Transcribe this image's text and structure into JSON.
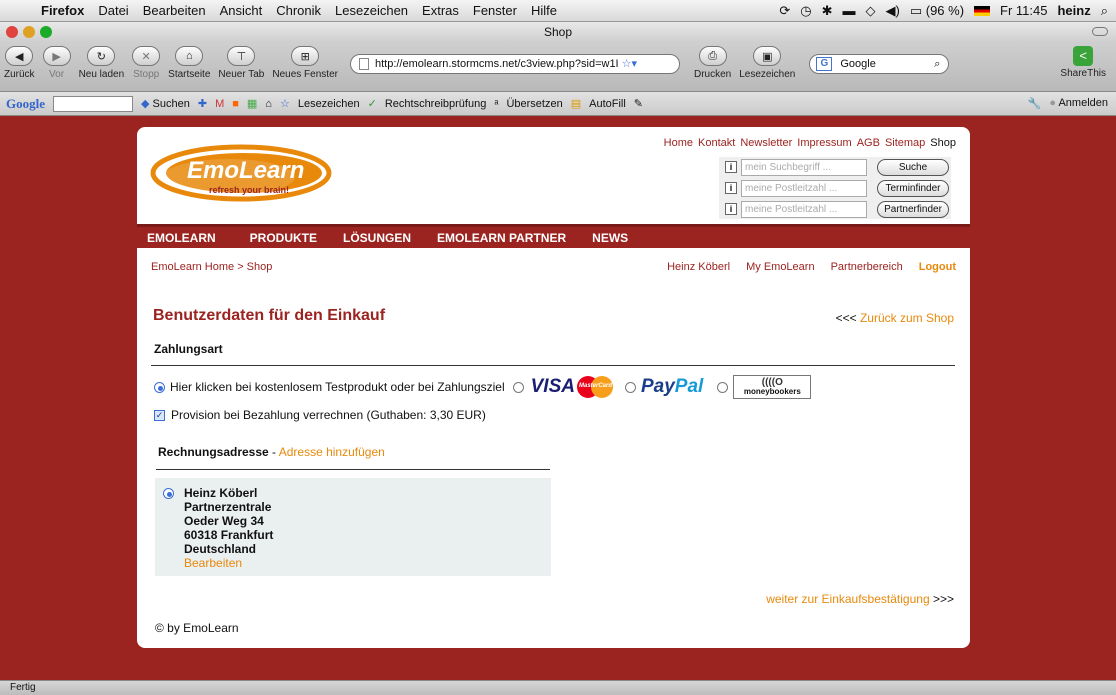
{
  "menubar": {
    "app": "Firefox",
    "items": [
      "Datei",
      "Bearbeiten",
      "Ansicht",
      "Chronik",
      "Lesezeichen",
      "Extras",
      "Fenster",
      "Hilfe"
    ],
    "battery": "(96 %)",
    "clock": "Fr 11:45",
    "user": "heinz"
  },
  "window": {
    "title": "Shop"
  },
  "toolbar": {
    "back": "Zurück",
    "forward": "Vor",
    "reload": "Neu laden",
    "stop": "Stopp",
    "home": "Startseite",
    "newtab": "Neuer Tab",
    "newwindow": "Neues Fenster",
    "url": "http://emolearn.stormcms.net/c3view.php?sid=w1I",
    "print": "Drucken",
    "bookmarks": "Lesezeichen",
    "search_placeholder": "Google",
    "sharethis": "ShareThis"
  },
  "googlebar": {
    "logo": "Google",
    "search": "Suchen",
    "bookmarks": "Lesezeichen",
    "spellcheck": "Rechtschreibprüfung",
    "translate": "Übersetzen",
    "autofill": "AutoFill",
    "signin": "Anmelden"
  },
  "site": {
    "topnav": [
      "Home",
      "Kontakt",
      "Newsletter",
      "Impressum",
      "AGB",
      "Sitemap"
    ],
    "topnav_active": "Shop",
    "logo_text": "EmoLearn",
    "logo_tagline": "refresh your brain!",
    "search_rows": [
      {
        "placeholder": "mein Suchbegriff ...",
        "button": "Suche"
      },
      {
        "placeholder": "meine Postleitzahl ...",
        "button": "Terminfinder"
      },
      {
        "placeholder": "meine Postleitzahl ...",
        "button": "Partnerfinder"
      }
    ],
    "mainnav": [
      "EMOLEARN",
      "PRODUKTE",
      "LÖSUNGEN",
      "EMOLEARN PARTNER",
      "NEWS"
    ],
    "breadcrumb": "EmoLearn Home > Shop",
    "usernav": [
      "Heinz Köberl",
      "My EmoLearn",
      "Partnerbereich"
    ],
    "logout": "Logout",
    "heading": "Benutzerdaten für den Einkauf",
    "back_arrows": "<<<",
    "back_link": "Zurück zum Shop",
    "payment_title": "Zahlungsart",
    "payment_option_label": "Hier klicken bei kostenlosem Testprodukt oder bei Zahlungsziel",
    "visa": "VISA",
    "mastercard": "MasterCard",
    "paypal_a": "Pay",
    "paypal_b": "Pal",
    "moneybookers": "moneybookers",
    "provision_label": "Provision bei Bezahlung verrechnen (Guthaben: 3,30 EUR)",
    "billing_title": "Rechnungsadresse",
    "billing_sep": " - ",
    "billing_add": "Adresse hinzufügen",
    "address": {
      "name": "Heinz Köberl",
      "company": "Partnerzentrale",
      "street": "Oeder Weg 34",
      "city": "60318 Frankfurt",
      "country": "Deutschland",
      "edit": "Bearbeiten"
    },
    "next_link": "weiter zur Einkaufsbestätigung",
    "next_arrows": ">>>",
    "copyright": "© by EmoLearn"
  },
  "statusbar": {
    "text": "Fertig"
  },
  "colors": {
    "brand": "#9b2320",
    "link_orange": "#e8890c"
  }
}
